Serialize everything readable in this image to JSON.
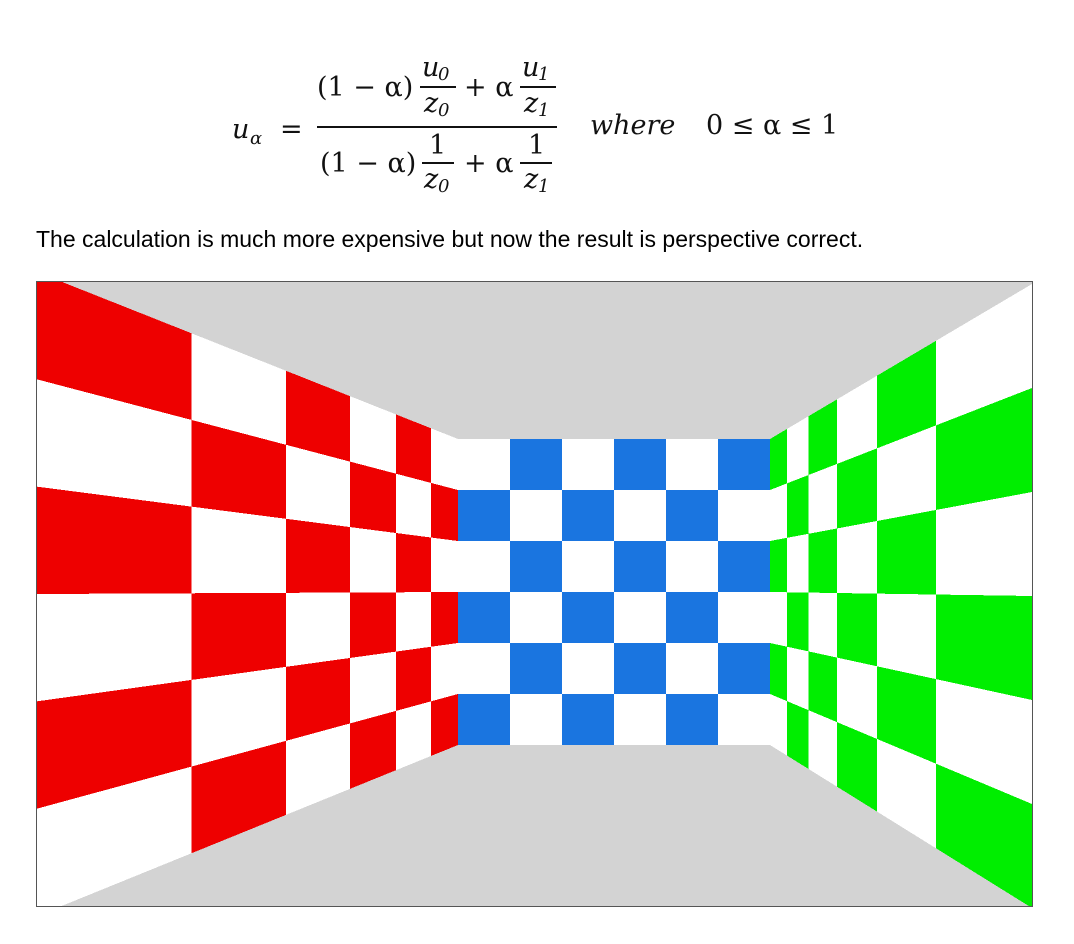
{
  "formula": {
    "lhs": "u",
    "lhs_sub": "α",
    "equals": "=",
    "numerator": {
      "term1_coeff": "(1 − α)",
      "term1_top": "u",
      "term1_top_sub": "0",
      "term1_bottom": "z",
      "term1_bottom_sub": "0",
      "plus": "+ α",
      "term2_top": "u",
      "term2_top_sub": "1",
      "term2_bottom": "z",
      "term2_bottom_sub": "1"
    },
    "denominator": {
      "term1_coeff": "(1 − α)",
      "term1_top": "1",
      "term1_bottom": "z",
      "term1_bottom_sub": "0",
      "plus": "+ α",
      "term2_top": "1",
      "term2_bottom": "z",
      "term2_bottom_sub": "1"
    },
    "where_word": "where",
    "condition": "0 ≤ α ≤ 1"
  },
  "caption": "The calculation is much more expensive but now the result is perspective correct.",
  "scene": {
    "colors": {
      "background": "#d3d3d3",
      "left_wall": "#ee0000",
      "back_wall": "#1a75e0",
      "right_wall": "#00ee00",
      "checker_light": "#ffffff"
    },
    "back_wall_grid": {
      "columns": 6,
      "rows": 6
    },
    "side_wall_grid": {
      "columns": 6,
      "rows": 6
    }
  }
}
